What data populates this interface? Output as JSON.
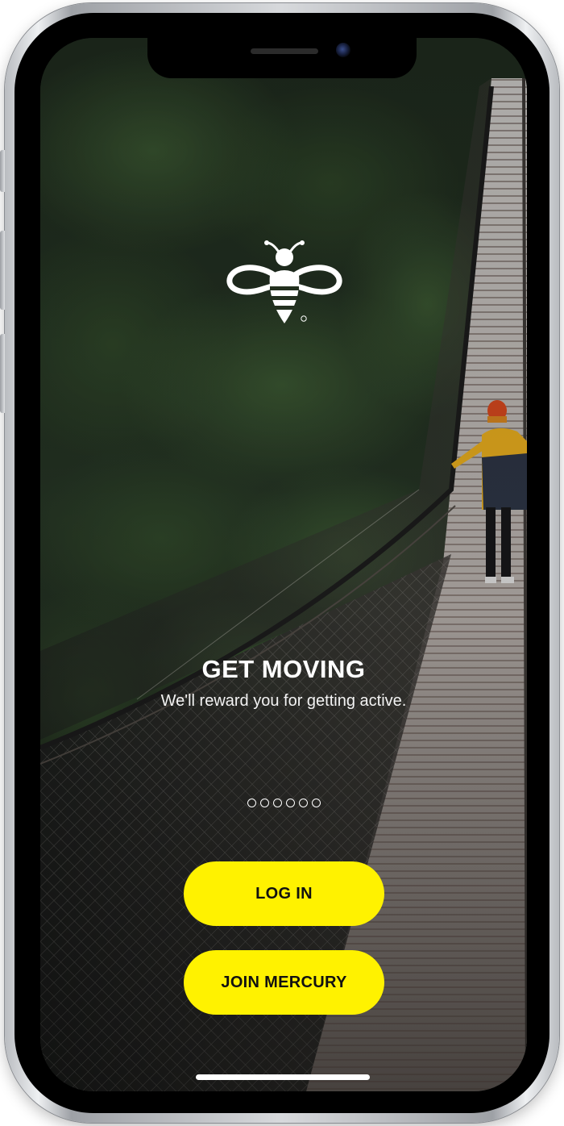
{
  "onboarding": {
    "title": "GET MOVING",
    "subtitle": "We'll reward you for getting active.",
    "page_indicator": {
      "total_pages": 6
    },
    "login_label": "LOG IN",
    "join_label": "JOIN MERCURY"
  },
  "colors": {
    "button_background": "#fff200",
    "button_text": "#111111",
    "text": "#ffffff"
  },
  "icons": {
    "logo": "bee-logo-icon"
  }
}
